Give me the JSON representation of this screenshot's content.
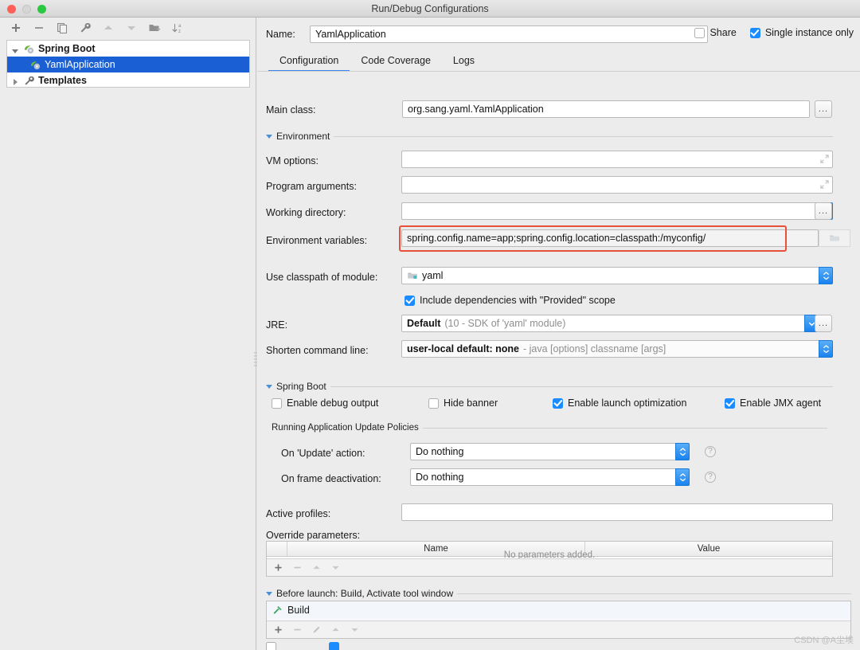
{
  "window": {
    "title": "Run/Debug Configurations",
    "traffic_lights": [
      "close-red",
      "minimize-gray",
      "zoom-green"
    ]
  },
  "sidebar": {
    "toolbar": [
      {
        "name": "add-icon",
        "glyph": "+"
      },
      {
        "name": "remove-icon",
        "glyph": "−"
      },
      {
        "name": "copy-icon",
        "glyph": "copy"
      },
      {
        "name": "edit-templates-icon",
        "glyph": "wrench"
      },
      {
        "name": "move-up-icon",
        "glyph": "up"
      },
      {
        "name": "move-down-icon",
        "glyph": "down"
      },
      {
        "name": "new-folder-icon",
        "glyph": "folder-plus"
      },
      {
        "name": "sort-alphabetically-icon",
        "glyph": "sort-az"
      }
    ],
    "tree": [
      {
        "label": "Spring Boot",
        "icon": "spring-boot-icon",
        "expanded": true,
        "selected": false,
        "level": 0
      },
      {
        "label": "YamlApplication",
        "icon": "spring-boot-icon",
        "expanded": null,
        "selected": true,
        "level": 1
      },
      {
        "label": "Templates",
        "icon": "wrench-icon",
        "expanded": false,
        "selected": false,
        "level": 0
      }
    ]
  },
  "header": {
    "name_label": "Name:",
    "name_value": "YamlApplication",
    "share_label": "Share",
    "share_checked": false,
    "single_instance_label": "Single instance only",
    "single_instance_checked": true
  },
  "tabs": [
    {
      "label": "Configuration",
      "active": true
    },
    {
      "label": "Code Coverage",
      "active": false
    },
    {
      "label": "Logs",
      "active": false
    }
  ],
  "form": {
    "main_class_label": "Main class:",
    "main_class_value": "org.sang.yaml.YamlApplication",
    "browse_label": "...",
    "environment_section": "Environment",
    "vm_options_label": "VM options:",
    "vm_options_value": "",
    "program_arguments_label": "Program arguments:",
    "program_arguments_value": "",
    "working_directory_label": "Working directory:",
    "working_directory_value": "",
    "environment_variables_label": "Environment variables:",
    "environment_variables_value": "spring.config.name=app;spring.config.location=classpath:/myconfig/",
    "use_classpath_label": "Use classpath of module:",
    "use_classpath_value": "yaml",
    "include_dependencies_label": "Include dependencies with \"Provided\" scope",
    "include_dependencies_checked": true,
    "jre_label": "JRE:",
    "jre_value": "Default",
    "jre_hint": "(10 - SDK of 'yaml' module)",
    "shorten_label": "Shorten command line:",
    "shorten_value": "user-local default: none",
    "shorten_hint": "- java [options] classname [args]",
    "spring_boot_section": "Spring Boot",
    "spring_checks": [
      {
        "label": "Enable debug output",
        "checked": false
      },
      {
        "label": "Hide banner",
        "checked": false
      },
      {
        "label": "Enable launch optimization",
        "checked": true
      },
      {
        "label": "Enable JMX agent",
        "checked": true
      }
    ],
    "update_policies_section": "Running Application Update Policies",
    "on_update_label": "On 'Update' action:",
    "on_update_value": "Do nothing",
    "on_frame_label": "On frame deactivation:",
    "on_frame_value": "Do nothing",
    "help_glyph": "?",
    "active_profiles_label": "Active profiles:",
    "active_profiles_value": "",
    "override_parameters_label": "Override parameters:",
    "override_table": {
      "columns": [
        "Name",
        "Value"
      ],
      "rows": [],
      "empty_text": "No parameters added.",
      "toolbar": [
        {
          "name": "add-parameter-icon",
          "glyph": "+",
          "enabled": true
        },
        {
          "name": "remove-parameter-icon",
          "glyph": "−",
          "enabled": false
        },
        {
          "name": "move-parameter-up-icon",
          "glyph": "up",
          "enabled": false
        },
        {
          "name": "move-parameter-down-icon",
          "glyph": "down",
          "enabled": false
        }
      ]
    }
  },
  "before_launch": {
    "section_title": "Before launch: Build, Activate tool window",
    "items": [
      {
        "label": "Build",
        "icon": "hammer-icon"
      }
    ],
    "toolbar": [
      {
        "name": "add-task-icon",
        "glyph": "+",
        "enabled": true
      },
      {
        "name": "remove-task-icon",
        "glyph": "−",
        "enabled": false
      },
      {
        "name": "edit-task-icon",
        "glyph": "pencil",
        "enabled": false
      },
      {
        "name": "move-task-up-icon",
        "glyph": "up",
        "enabled": false
      },
      {
        "name": "move-task-down-icon",
        "glyph": "down",
        "enabled": false
      }
    ]
  },
  "watermark": "CSDN @A尘埃",
  "colors": {
    "accent_blue": "#1a8cff",
    "selection_blue": "#1a5fd4",
    "tab_underline": "#3c86f2",
    "annotation_red": "#e8503a",
    "window_bg": "#ececec"
  }
}
